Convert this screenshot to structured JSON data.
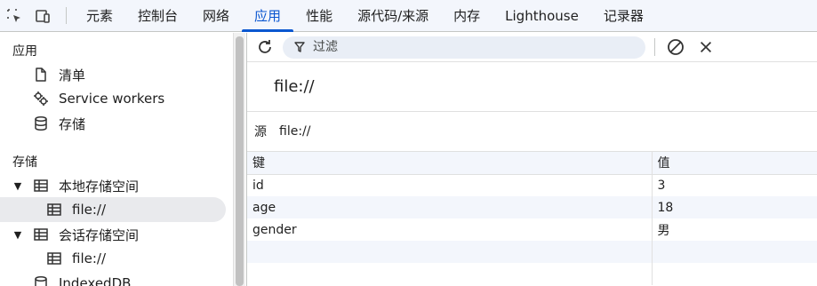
{
  "tabs": [
    {
      "label": "元素",
      "active": false
    },
    {
      "label": "控制台",
      "active": false
    },
    {
      "label": "网络",
      "active": false
    },
    {
      "label": "应用",
      "active": true
    },
    {
      "label": "性能",
      "active": false
    },
    {
      "label": "源代码/来源",
      "active": false
    },
    {
      "label": "内存",
      "active": false
    },
    {
      "label": "Lighthouse",
      "active": false
    },
    {
      "label": "记录器",
      "active": false
    }
  ],
  "sidebar": {
    "app_section": "应用",
    "app_items": [
      {
        "label": "清单",
        "icon": "document-icon"
      },
      {
        "label": "Service workers",
        "icon": "gears-icon"
      },
      {
        "label": "存储",
        "icon": "database-icon"
      }
    ],
    "storage_section": "存储",
    "local_storage": {
      "label": "本地存储空间",
      "child": "file://"
    },
    "session_storage": {
      "label": "会话存储空间",
      "child": "file://"
    },
    "indexeddb": "IndexedDB"
  },
  "toolbar": {
    "filter_placeholder": "过滤"
  },
  "origin": {
    "title": "file://",
    "label": "源",
    "value": "file://"
  },
  "table": {
    "columns": [
      "键",
      "值"
    ],
    "rows": [
      {
        "key": "id",
        "value": "3"
      },
      {
        "key": "age",
        "value": "18"
      },
      {
        "key": "gender",
        "value": "男"
      }
    ]
  },
  "colors": {
    "accent": "#0b57d0",
    "toolbar_bg": "#f3f6fc",
    "selected_bg": "#e9eaed"
  }
}
